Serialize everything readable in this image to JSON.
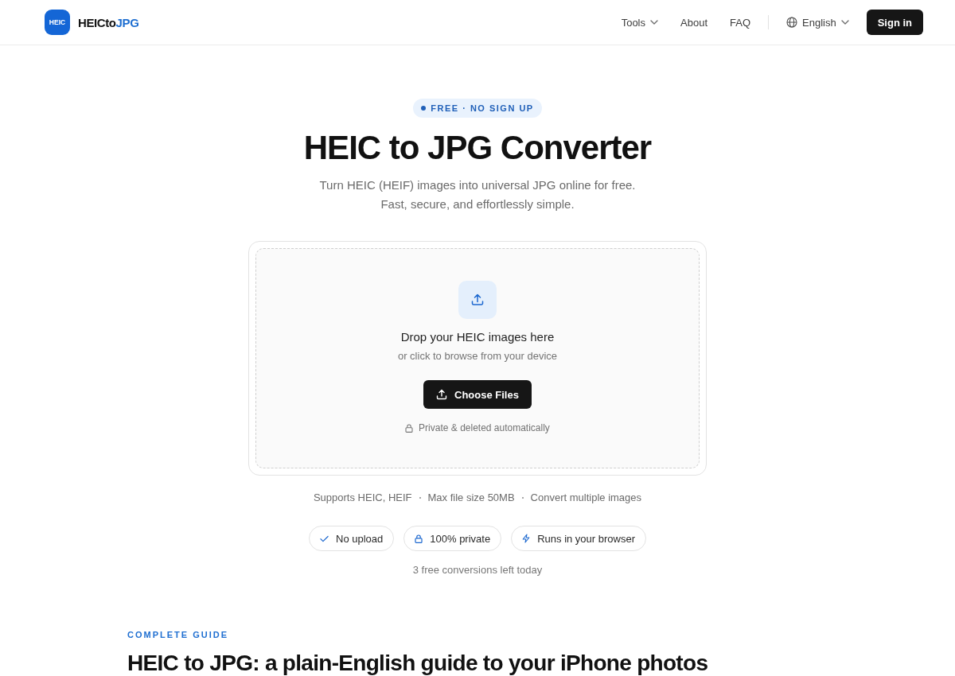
{
  "header": {
    "logo": {
      "mark": "HEIC",
      "name": "HEICto",
      "name_accent": "JPG"
    },
    "nav": [
      {
        "label": "Tools",
        "kind": "dropdown"
      },
      {
        "label": "About",
        "kind": "link"
      },
      {
        "label": "FAQ",
        "kind": "link"
      }
    ],
    "language": "English",
    "sign_in": "Sign in"
  },
  "hero": {
    "badge": "FREE · NO SIGN UP",
    "title": "HEIC to JPG Converter",
    "subtitle": [
      "Turn HEIC (HEIF) images into universal JPG online for free.",
      "Fast, secure, and effortlessly simple."
    ]
  },
  "dropzone": {
    "title": "Drop your HEIC images here",
    "hint": "or click to browse from your device",
    "button": "Choose Files",
    "privacy": "Private & deleted automatically"
  },
  "supports": [
    "Supports HEIC, HEIF",
    "Max file size 50MB",
    "Convert multiple images"
  ],
  "features": [
    {
      "label": "No upload",
      "kind": "check"
    },
    {
      "label": "100% private",
      "kind": "lock"
    },
    {
      "label": "Runs in your browser",
      "kind": "bolt"
    }
  ],
  "quota": "3 free conversions left today",
  "guide": {
    "eyebrow": "COMPLETE GUIDE",
    "title": "HEIC to JPG: a plain-English guide to your iPhone photos"
  }
}
